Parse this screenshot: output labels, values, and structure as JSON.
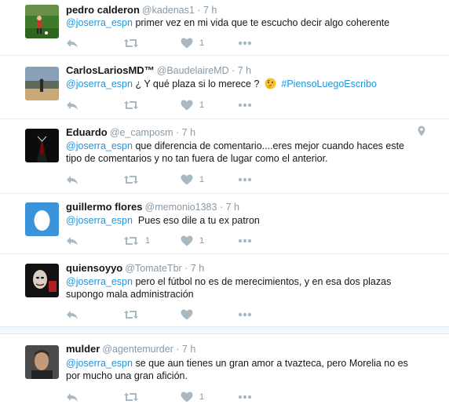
{
  "tweets": [
    {
      "name": "pedro calderon",
      "handle": "@kadenas1",
      "time": "7 h",
      "mention": "@joserra_espn",
      "text": " primer vez en mi vida que te escucho decir algo coherente",
      "text_line2": "",
      "emoji": "",
      "hashtag": "",
      "retweets": "",
      "likes": "1",
      "geo": false,
      "avatar": "soccer-field-photo"
    },
    {
      "name": "CarlosLariosMD™",
      "handle": "@BaudelaireMD",
      "time": "7 h",
      "mention": "@joserra_espn",
      "text": " ¿ Y qué plaza si lo merece ?",
      "text_line2": "",
      "emoji": "thinking-face-emoji",
      "hashtag": "#PiensoLuegoEscribo",
      "retweets": "",
      "likes": "1",
      "geo": false,
      "avatar": "landscape-photo"
    },
    {
      "name": "Eduardo",
      "handle": "@e_camposm",
      "time": "7 h",
      "mention": "@joserra_espn",
      "text": " que diferencia de comentario....eres mejor cuando haces este",
      "text_line2": "tipo de comentarios y no tan fuera de lugar como el anterior.",
      "emoji": "",
      "hashtag": "",
      "retweets": "",
      "likes": "1",
      "geo": true,
      "avatar": "dark-suit-photo"
    },
    {
      "name": "guillermo flores",
      "handle": "@memonio1383",
      "time": "7 h",
      "mention": "@joserra_espn",
      "text": "  Pues eso dile a tu ex patron",
      "text_line2": "",
      "emoji": "",
      "hashtag": "",
      "retweets": "1",
      "likes": "1",
      "geo": false,
      "avatar": "default-egg-avatar"
    },
    {
      "name": "quiensoyyo",
      "handle": "@TomateTbr",
      "time": "7 h",
      "mention": "@joserra_espn",
      "text": " pero el fútbol no es de merecimientos, y en esa dos plazas",
      "text_line2": "supongo mala administración",
      "emoji": "",
      "hashtag": "",
      "retweets": "",
      "likes": "",
      "geo": false,
      "avatar": "masked-face-photo"
    },
    {
      "name": "mulder",
      "handle": "@agentemurder",
      "time": "7 h",
      "mention": "@joserra_espn",
      "text": " se que aun tienes un gran amor a tvazteca, pero Morelia no es",
      "text_line2": "por mucho una gran afición.",
      "emoji": "",
      "hashtag": "",
      "retweets": "",
      "likes": "1",
      "geo": false,
      "avatar": "man-portrait-photo"
    }
  ],
  "colors": {
    "link": "#1b95e0",
    "muted": "#8899a6",
    "icon": "#aab8c2",
    "divider": "#e6ecf0"
  },
  "separator": "·"
}
